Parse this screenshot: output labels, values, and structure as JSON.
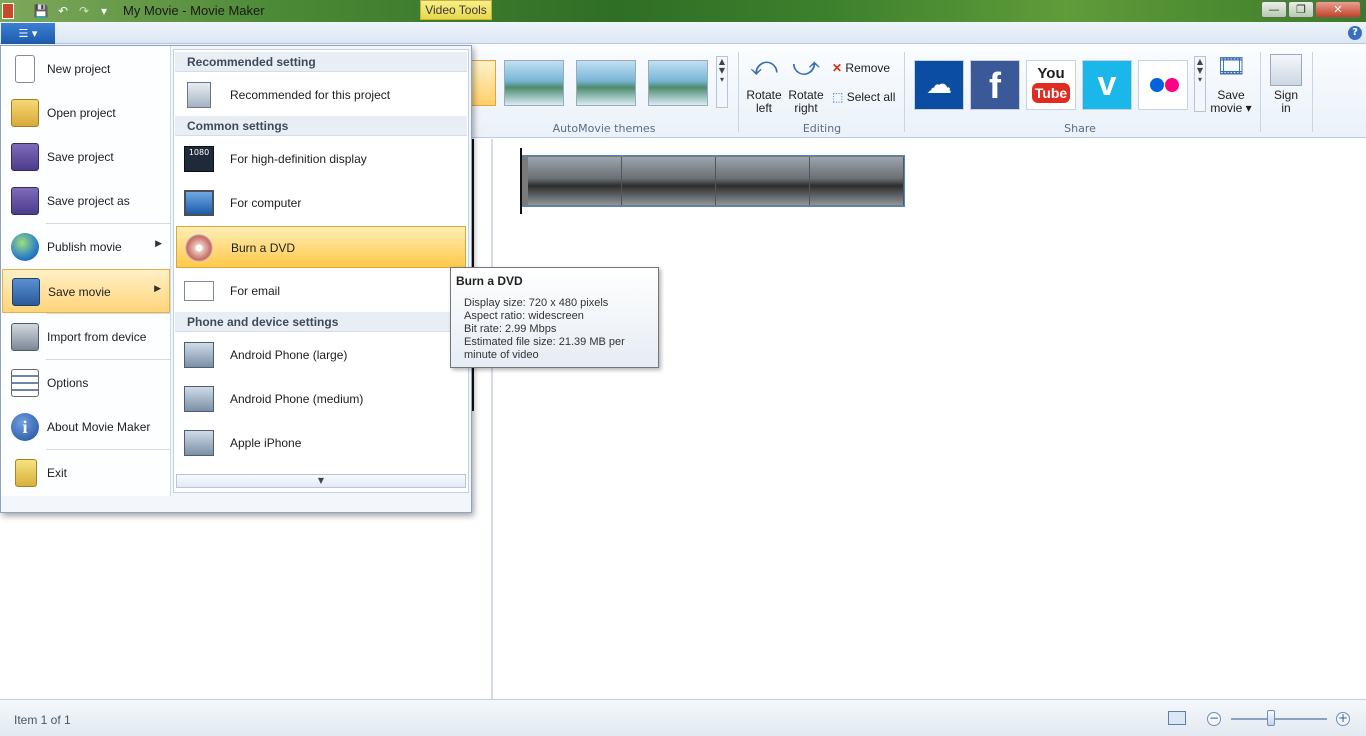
{
  "window": {
    "title": "My Movie - Movie Maker",
    "context_tab": "Video Tools",
    "minimize": "—",
    "maximize": "❐",
    "close": "✕"
  },
  "quick_access": {
    "save": "💾",
    "undo": "↶",
    "redo": "↷",
    "customize": "▾"
  },
  "ribbon": {
    "file_button": "☰ ▾",
    "help": "?",
    "groups": {
      "automovie": "AutoMovie themes",
      "editing": "Editing",
      "share": "Share"
    },
    "editing": {
      "rotate_left": [
        "Rotate",
        "left"
      ],
      "rotate_right": [
        "Rotate",
        "right"
      ],
      "remove": "Remove",
      "select_all": "Select all"
    },
    "share": {
      "save_movie": [
        "Save",
        "movie ▾"
      ],
      "sign_in": [
        "Sign",
        "in"
      ],
      "youtube_top": "You",
      "youtube_bottom": "Tube",
      "facebook": "f",
      "vimeo": "v"
    }
  },
  "file_menu": {
    "items": [
      {
        "label": "New project"
      },
      {
        "label": "Open project"
      },
      {
        "label": "Save project"
      },
      {
        "label": "Save project as"
      },
      {
        "label": "Publish movie"
      },
      {
        "label": "Save movie"
      },
      {
        "label": "Import from device"
      },
      {
        "label": "Options"
      },
      {
        "label": "About Movie Maker"
      },
      {
        "label": "Exit"
      }
    ],
    "submenu": {
      "headers": {
        "recommended": "Recommended setting",
        "common": "Common settings",
        "phone": "Phone and device settings"
      },
      "items": [
        {
          "label": "Recommended for this project"
        },
        {
          "label": "For high-definition display",
          "badge": "1080"
        },
        {
          "label": "For computer"
        },
        {
          "label": "Burn a DVD"
        },
        {
          "label": "For email"
        },
        {
          "label": "Android Phone (large)"
        },
        {
          "label": "Android Phone (medium)"
        },
        {
          "label": "Apple iPhone"
        }
      ]
    }
  },
  "tooltip": {
    "title": "Burn a DVD",
    "lines": [
      "Display size: 720 x 480 pixels",
      "Aspect ratio: widescreen",
      "Bit rate: 2.99 Mbps",
      "Estimated file size: 21.39 MB per",
      "minute of video"
    ]
  },
  "status": {
    "text": "Item 1 of 1",
    "zoom_minus": "−",
    "zoom_plus": "+"
  },
  "colors": {
    "accent_blue": "#1d59a8",
    "highlight_orange": "#ffc94a",
    "youtube_red": "#e02b20",
    "facebook_blue": "#3b5998",
    "vimeo_blue": "#1ab7ea",
    "onedrive_blue": "#0a4da3"
  }
}
